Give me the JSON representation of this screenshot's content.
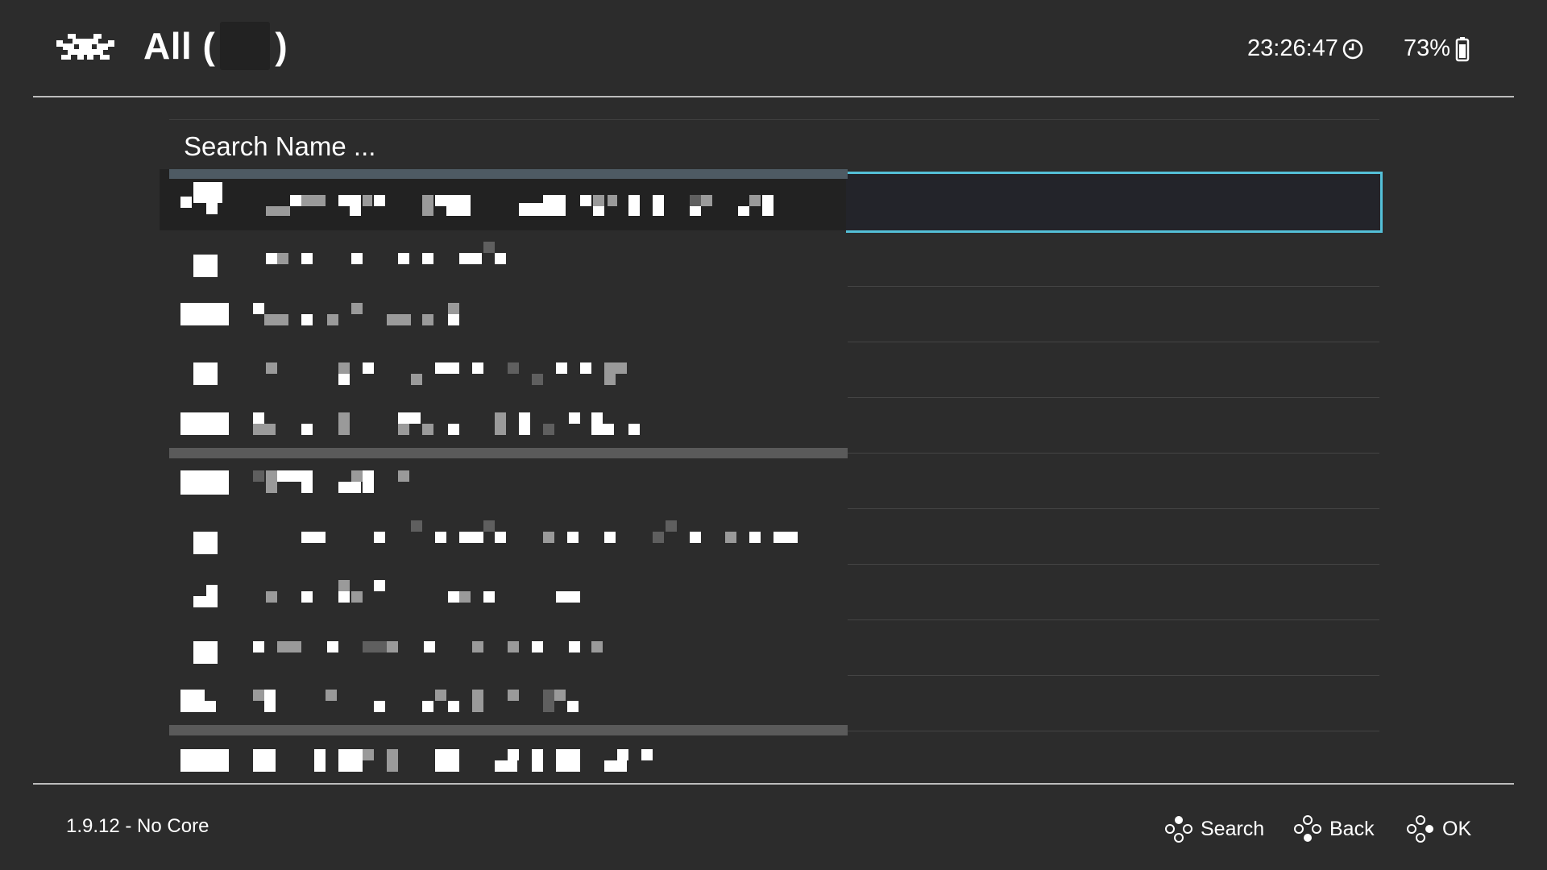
{
  "header": {
    "logo_icon": "retroarch-invader-icon",
    "title_prefix": "All (",
    "title_suffix": ")",
    "time": "23:26:47",
    "clock_icon": "clock-icon",
    "battery_percent": "73%",
    "battery_icon": "battery-icon"
  },
  "search": {
    "placeholder": "Search Name ..."
  },
  "footer": {
    "version_text": "1.9.12 - No Core",
    "hints": [
      {
        "icon": "gamepad-button-icon",
        "label": "Search"
      },
      {
        "icon": "gamepad-button-icon",
        "label": "Back"
      },
      {
        "icon": "gamepad-button-icon",
        "label": "OK"
      }
    ]
  },
  "colors": {
    "background": "#2c2c2c",
    "selection_border": "#54c0d8",
    "text": "#ffffff"
  }
}
